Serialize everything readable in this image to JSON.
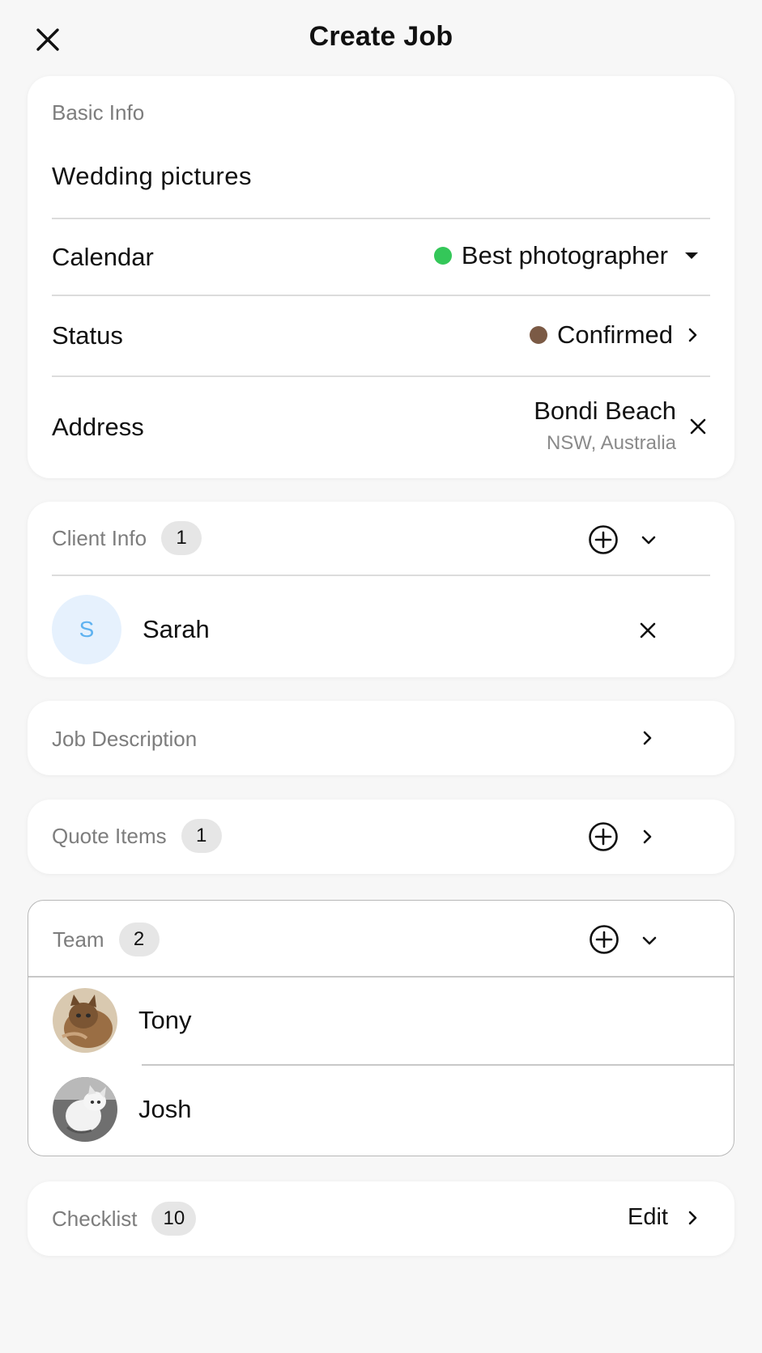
{
  "header": {
    "title": "Create Job"
  },
  "basic_info": {
    "label": "Basic Info",
    "job_title": "Wedding pictures",
    "calendar": {
      "label": "Calendar",
      "value": "Best photographer",
      "dot_color": "#34c759"
    },
    "status": {
      "label": "Status",
      "value": "Confirmed",
      "dot_color": "#7b5a45"
    },
    "address": {
      "label": "Address",
      "line1": "Bondi Beach",
      "line2": "NSW, Australia"
    }
  },
  "client_info": {
    "label": "Client Info",
    "count": "1",
    "clients": [
      {
        "initial": "S",
        "name": "Sarah"
      }
    ]
  },
  "job_description": {
    "label": "Job Description"
  },
  "quote_items": {
    "label": "Quote Items",
    "count": "1"
  },
  "team": {
    "label": "Team",
    "count": "2",
    "members": [
      {
        "name": "Tony"
      },
      {
        "name": "Josh"
      }
    ]
  },
  "checklist": {
    "label": "Checklist",
    "count": "10",
    "edit_label": "Edit"
  },
  "colors": {
    "background": "#f7f7f7",
    "card": "#ffffff",
    "avatar_bg": "#e6f1fd",
    "avatar_text": "#5fb2f0"
  }
}
